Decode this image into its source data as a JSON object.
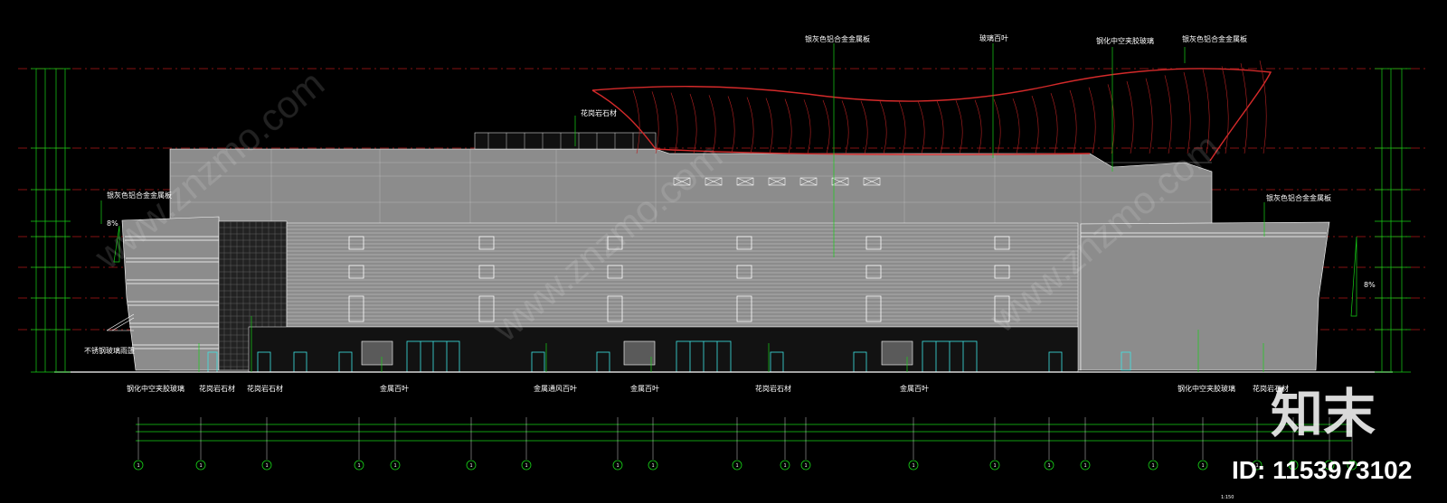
{
  "annotations": {
    "top": [
      "银灰色铝合金金属板",
      "玻璃百叶",
      "钢化中空夹胶玻璃",
      "银灰色铝合金金属板"
    ],
    "roof_stone": "花岗岩石材",
    "left_metal": "银灰色铝合金金属板",
    "right_metal": "银灰色铝合金金属板",
    "canopy": "不锈钢玻璃雨篷",
    "bottom": [
      "钢化中空夹胶玻璃",
      "花岗岩石材",
      "花岗岩石材",
      "金属百叶",
      "金属通风百叶",
      "金属百叶",
      "花岗岩石材",
      "金属百叶",
      "钢化中空夹胶玻璃",
      "花岗岩石材"
    ],
    "slope_left": "8%",
    "slope_right": "8%"
  },
  "grid_axes": [
    "1",
    "1",
    "1",
    "1",
    "1",
    "1",
    "1",
    "1",
    "1",
    "1",
    "1",
    "1",
    "1",
    "1",
    "1",
    "1",
    "1",
    "1",
    "1",
    "1",
    "1",
    "1"
  ],
  "scale": "1:150",
  "watermark": {
    "brand": "知末",
    "id": "ID: 1153973102",
    "diagonal": "www.znzmo.com"
  },
  "colors": {
    "background": "#000000",
    "facade": "#8c8c8c",
    "roof_curve": "#d42a2a",
    "dim_green": "#17d217",
    "glass_cyan": "#3ee7e7",
    "line_white": "#ffffff",
    "dash_red": "#b01818"
  }
}
